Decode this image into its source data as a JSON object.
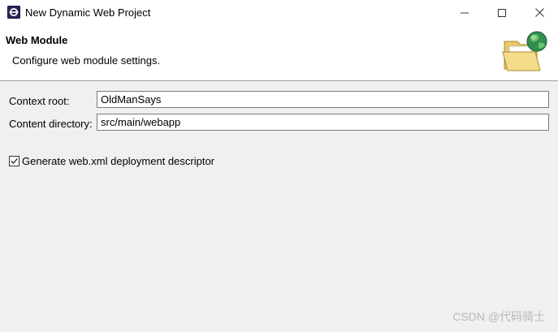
{
  "window": {
    "title": "New Dynamic Web Project",
    "icon": "eclipse-app-icon"
  },
  "banner": {
    "title": "Web Module",
    "description": "Configure web module settings.",
    "image": "folder-globe-icon"
  },
  "form": {
    "context_root": {
      "label": "Context root:",
      "value": "OldManSays"
    },
    "content_directory": {
      "label": "Content directory:",
      "value": "src/main/webapp"
    },
    "generate_web_xml": {
      "label": "Generate web.xml deployment descriptor",
      "checked": true
    }
  },
  "watermark": "CSDN @代码骑士"
}
